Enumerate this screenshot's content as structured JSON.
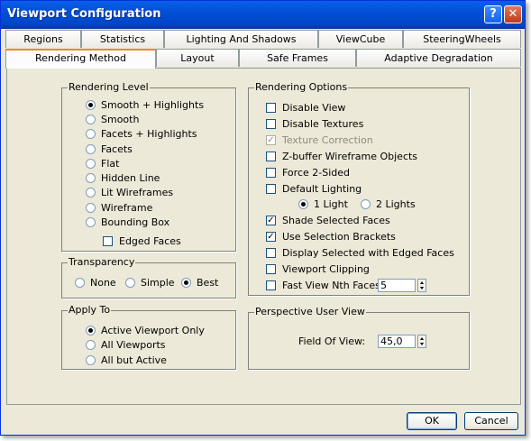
{
  "window": {
    "title": "Viewport Configuration",
    "help_glyph": "?",
    "close_glyph": "✕"
  },
  "tabs_row1": [
    "Regions",
    "Statistics",
    "Lighting And Shadows",
    "ViewCube",
    "SteeringWheels"
  ],
  "tabs_row2": [
    "Rendering Method",
    "Layout",
    "Safe Frames",
    "Adaptive Degradation"
  ],
  "active_tab": "Rendering Method",
  "rendering_level": {
    "label": "Rendering Level",
    "options": [
      "Smooth + Highlights",
      "Smooth",
      "Facets + Highlights",
      "Facets",
      "Flat",
      "Hidden Line",
      "Lit Wireframes",
      "Wireframe",
      "Bounding Box"
    ],
    "selected": "Smooth + Highlights",
    "edged_faces": {
      "label": "Edged Faces",
      "checked": false
    }
  },
  "transparency": {
    "label": "Transparency",
    "options": [
      "None",
      "Simple",
      "Best"
    ],
    "selected": "Best"
  },
  "apply_to": {
    "label": "Apply To",
    "options": [
      "Active Viewport Only",
      "All Viewports",
      "All but Active"
    ],
    "selected": "Active Viewport Only"
  },
  "rendering_options": {
    "label": "Rendering Options",
    "disable_view": {
      "label": "Disable View",
      "checked": false
    },
    "disable_textures": {
      "label": "Disable Textures",
      "checked": false
    },
    "texture_correction": {
      "label": "Texture Correction",
      "checked": true,
      "disabled": true
    },
    "zbuffer_wireframe": {
      "label": "Z-buffer Wireframe Objects",
      "checked": false
    },
    "force_2_sided": {
      "label": "Force 2-Sided",
      "checked": false
    },
    "default_lighting": {
      "label": "Default Lighting",
      "checked": false
    },
    "lights": {
      "one": "1 Light",
      "two": "2 Lights",
      "selected": "1 Light"
    },
    "shade_selected_faces": {
      "label": "Shade Selected Faces",
      "checked": true
    },
    "use_selection_brackets": {
      "label": "Use Selection Brackets",
      "checked": true
    },
    "display_selected_edged": {
      "label": "Display Selected with Edged Faces",
      "checked": false
    },
    "viewport_clipping": {
      "label": "Viewport Clipping",
      "checked": false
    },
    "fast_view": {
      "label": "Fast View Nth Faces:",
      "checked": false,
      "value": "5"
    }
  },
  "perspective_user_view": {
    "label": "Perspective User View",
    "field_of_view_label": "Field Of View:",
    "field_of_view_value": "45,0"
  },
  "buttons": {
    "ok": "OK",
    "cancel": "Cancel"
  }
}
